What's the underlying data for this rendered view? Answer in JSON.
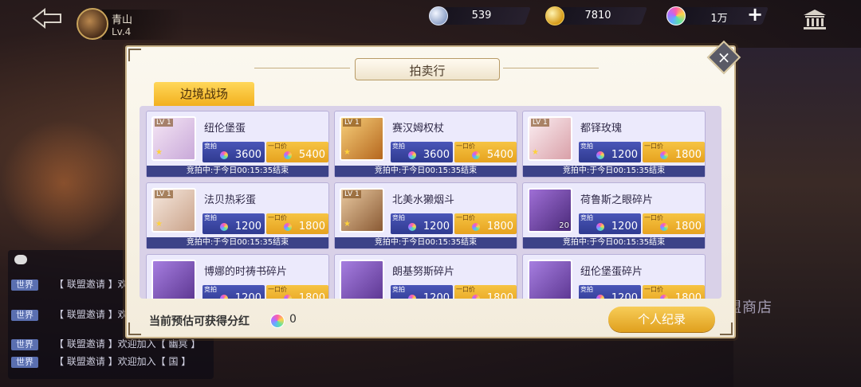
{
  "player": {
    "name": "青山",
    "level": "Lv.4"
  },
  "currencies": [
    {
      "icon": "silver-coin-icon",
      "value": "539"
    },
    {
      "icon": "gold-coin-icon",
      "value": "7810"
    },
    {
      "icon": "gem-icon",
      "value": "1万"
    }
  ],
  "background_text": {
    "shop": "盟商店"
  },
  "chat": {
    "messages": [
      {
        "channel": "世界",
        "text": "【 联盟邀请 】欢"
      },
      {
        "channel": "世界",
        "text": "【 联盟邀请 】欢"
      },
      {
        "channel": "世界",
        "text": "【 联盟邀请 】欢迎加入【 幽冥 】"
      },
      {
        "channel": "世界",
        "text": "【 联盟邀请 】欢迎加入【 国 】"
      }
    ]
  },
  "modal": {
    "title": "拍卖行",
    "tab": "边境战场",
    "bid_label": "竞拍",
    "buyout_label": "一口价",
    "items": [
      {
        "name": "纽伦堡蛋",
        "lv": "LV 1",
        "bid": "3600",
        "buyout": "5400",
        "status": "竞拍中:于今日00:15:35结束",
        "color": "#e6c8ea"
      },
      {
        "name": "赛汉姆权杖",
        "lv": "LV 1",
        "bid": "3600",
        "buyout": "5400",
        "status": "竞拍中:于今日00:15:35结束",
        "color": "#f0b95a"
      },
      {
        "name": "都铎玫瑰",
        "lv": "LV 1",
        "bid": "1200",
        "buyout": "1800",
        "status": "竞拍中:于今日00:15:35结束",
        "color": "#f3e3ea"
      },
      {
        "name": "法贝热彩蛋",
        "lv": "LV 1",
        "bid": "1200",
        "buyout": "1800",
        "status": "竞拍中:于今日00:15:35结束",
        "color": "#f1e2d8"
      },
      {
        "name": "北美水獭烟斗",
        "lv": "LV 1",
        "bid": "1200",
        "buyout": "1800",
        "status": "竞拍中:于今日00:15:35结束",
        "color": "#d9b48a"
      },
      {
        "name": "荷鲁斯之眼碎片",
        "count": "20",
        "bid": "1200",
        "buyout": "1800",
        "status": "竞拍中:于今日00:15:35结束",
        "color": "#7a4fb8"
      },
      {
        "name": "博娜的时祷书碎片",
        "bid": "1200",
        "buyout": "1800",
        "color": "#8a5ac8"
      },
      {
        "name": "朗基努斯碎片",
        "bid": "1200",
        "buyout": "1800",
        "color": "#8a5ac8"
      },
      {
        "name": "纽伦堡蛋碎片",
        "bid": "1200",
        "buyout": "1800",
        "color": "#8a5ac8"
      }
    ],
    "bonus_label": "当前预估可获得分红",
    "bonus_value": "0",
    "record_button": "个人纪录"
  }
}
